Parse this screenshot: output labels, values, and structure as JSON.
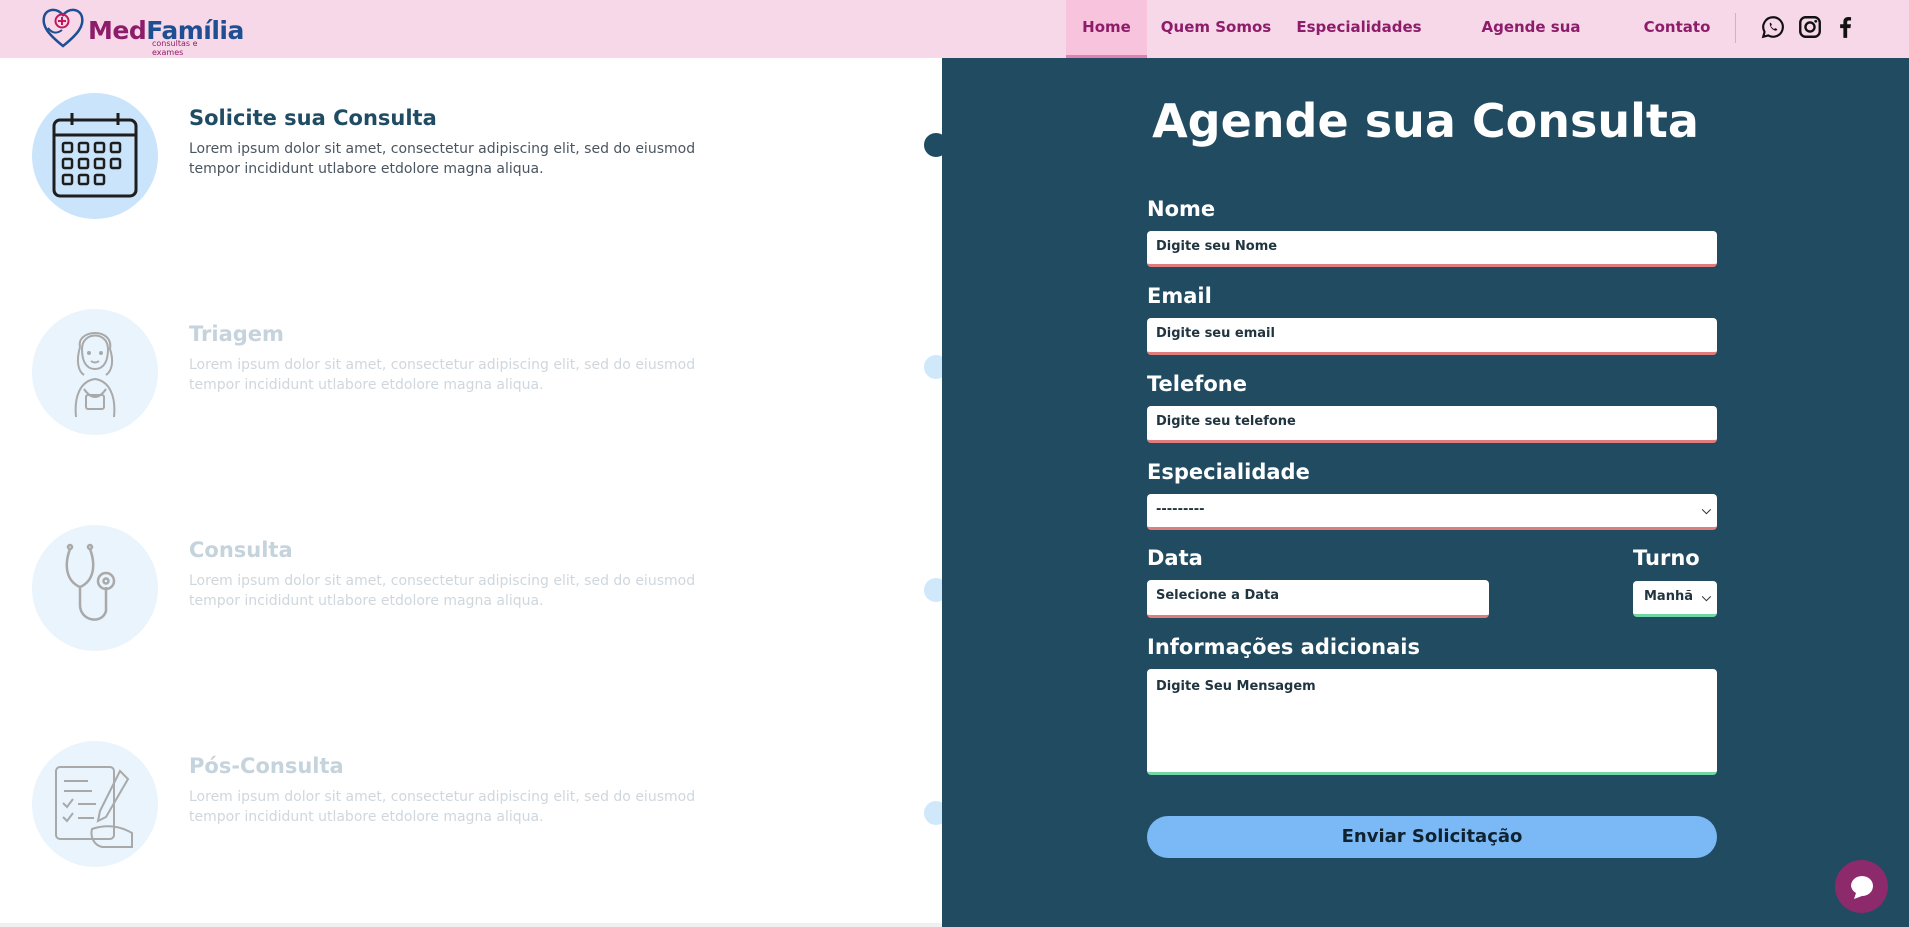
{
  "brand": {
    "name_part1": "Med",
    "name_part2": "Família",
    "tagline": "consultas e exames"
  },
  "nav": {
    "items": [
      {
        "label": "Home",
        "active": true
      },
      {
        "label": "Quem Somos",
        "active": false
      },
      {
        "label": "Especialidades",
        "active": false
      },
      {
        "label": "Agende sua Consulta",
        "active": false
      },
      {
        "label": "Contato",
        "active": false
      }
    ],
    "social": [
      "whatsapp-icon",
      "instagram-icon",
      "facebook-icon"
    ]
  },
  "steps": [
    {
      "title": "Solicite sua Consulta",
      "text": "Lorem ipsum dolor sit amet, consectetur adipiscing elit, sed do eiusmod tempor incididunt utlabore etdolore magna aliqua.",
      "icon": "calendar-icon",
      "active": true
    },
    {
      "title": "Triagem",
      "text": "Lorem ipsum dolor sit amet, consectetur adipiscing elit, sed do eiusmod tempor incididunt utlabore etdolore magna aliqua.",
      "icon": "nurse-icon",
      "active": false
    },
    {
      "title": "Consulta",
      "text": "Lorem ipsum dolor sit amet, consectetur adipiscing elit, sed do eiusmod tempor incididunt utlabore etdolore magna aliqua.",
      "icon": "stethoscope-icon",
      "active": false
    },
    {
      "title": "Pós-Consulta",
      "text": "Lorem ipsum dolor sit amet, consectetur adipiscing elit, sed do eiusmod tempor incididunt utlabore etdolore magna aliqua.",
      "icon": "prescription-icon",
      "active": false
    }
  ],
  "form": {
    "title": "Agende sua Consulta",
    "nome_label": "Nome",
    "nome_placeholder": "Digite seu Nome",
    "email_label": "Email",
    "email_placeholder": "Digite seu email",
    "telefone_label": "Telefone",
    "telefone_placeholder": "Digite seu telefone",
    "especialidade_label": "Especialidade",
    "especialidade_value": "---------",
    "data_label": "Data",
    "data_placeholder": "Selecione a Data",
    "turno_label": "Turno",
    "turno_value": "Manhã",
    "info_label": "Informações adicionais",
    "info_placeholder": "Digite Seu Mensagem",
    "submit_label": "Enviar Solicitação"
  },
  "colors": {
    "nav_bg": "#f7d8e8",
    "brand_purple": "#8d1d6a",
    "panel_bg": "#214b60",
    "button_blue": "#7ab9f5",
    "accent_red": "#e07c7c",
    "accent_green": "#70d6a6"
  }
}
